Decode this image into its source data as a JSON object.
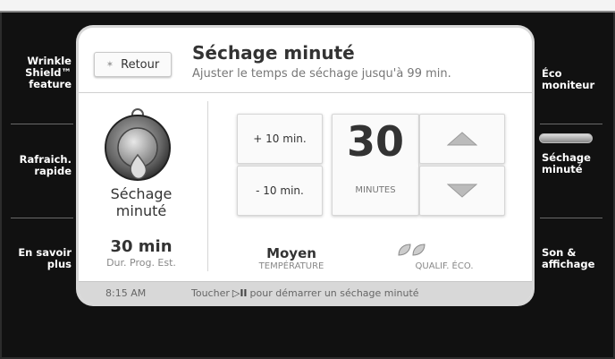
{
  "sidebar_left": [
    {
      "label_line1": "Wrinkle",
      "label_line2": "Shield™",
      "label_line3": "feature"
    },
    {
      "label_line1": "Rafraich.",
      "label_line2": "rapide"
    },
    {
      "label_line1": "En savoir",
      "label_line2": "plus"
    }
  ],
  "sidebar_right": [
    {
      "label_line1": "Éco",
      "label_line2": "moniteur"
    },
    {
      "label_line1": "Séchage",
      "label_line2": "minuté"
    },
    {
      "label_line1": "Son &",
      "label_line2": "affichage"
    }
  ],
  "header": {
    "back_label": "Retour",
    "title": "Séchage minuté",
    "subtitle": "Ajuster le temps de séchage jusqu'à 99 min."
  },
  "mode": {
    "name_line1": "Séchage",
    "name_line2": "minuté",
    "icon": "dryer-drop-icon"
  },
  "duration": {
    "value": "30 min",
    "label": "Dur. Prog. Est."
  },
  "timer": {
    "plus_label": "+ 10 min.",
    "minus_label": "- 10 min.",
    "value": "30",
    "unit": "MINUTES"
  },
  "settings": {
    "temperature_value": "Moyen",
    "temperature_label": "TEMPÉRATURE",
    "eco_label": "QUALIF. ÉCO."
  },
  "status": {
    "time": "8:15 AM",
    "msg_before": "Toucher",
    "msg_icon": "▷II",
    "msg_after": "pour démarrer un séchage minuté"
  },
  "colors": {
    "background": "#111111",
    "panel": "#ffffff",
    "text": "#333333"
  }
}
